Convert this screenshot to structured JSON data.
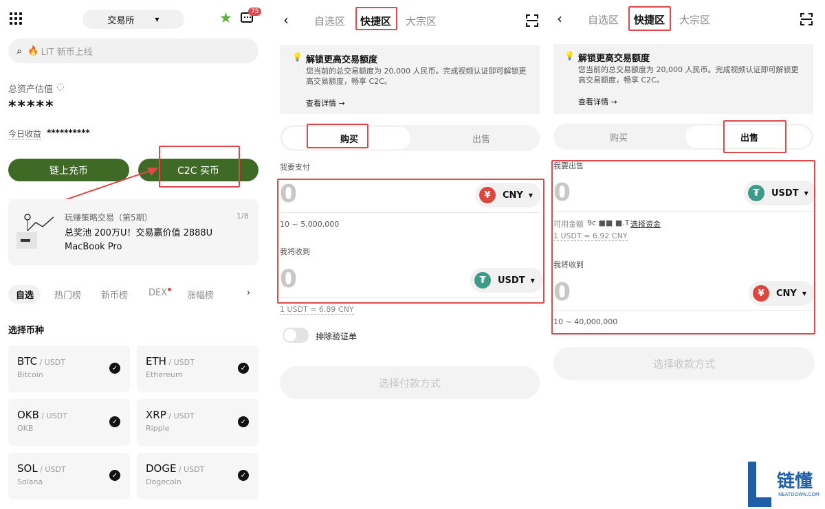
{
  "panel1": {
    "exchange_label": "交易所",
    "badge_count": "75",
    "search_placeholder": "LIT 新币上线",
    "assets_label": "总资产估值",
    "assets_value": "*****",
    "today_label": "今日收益",
    "today_value": "**********",
    "onchain_btn": "链上充币",
    "c2c_btn": "C2C 买币",
    "promo_title": "玩赚策略交易（第5期）",
    "promo_page": "1/8",
    "promo_text": "总奖池 200万U！交易赢价值 2888U MacBook Pro",
    "tabs": [
      "自选",
      "热门榜",
      "新币榜",
      "DEX",
      "涨幅榜"
    ],
    "section_title": "选择币种",
    "coins": [
      {
        "symbol": "BTC",
        "pair": " / USDT",
        "name": "Bitcoin"
      },
      {
        "symbol": "ETH",
        "pair": " / USDT",
        "name": "Ethereum"
      },
      {
        "symbol": "OKB",
        "pair": " / USDT",
        "name": "OKB"
      },
      {
        "symbol": "XRP",
        "pair": " / USDT",
        "name": "Ripple"
      },
      {
        "symbol": "SOL",
        "pair": " / USDT",
        "name": "Solana"
      },
      {
        "symbol": "DOGE",
        "pair": " / USDT",
        "name": "Dogecoin"
      }
    ]
  },
  "tabs": {
    "fav": "自选区",
    "quick": "快捷区",
    "bulk": "大宗区"
  },
  "banner": {
    "title": "解锁更高交易额度",
    "body": "您当前的总交易额度为 20,000 人民币。完成视频认证即可解锁更高交易额度，畅享 C2C。",
    "link": "查看详情 →"
  },
  "seg": {
    "buy": "购买",
    "sell": "出售"
  },
  "panel2": {
    "pay_label": "我要支付",
    "amount": "0",
    "pay_currency": "CNY",
    "pay_range": "10 ~ 5,000,000",
    "receive_label": "我将收到",
    "receive_amount": "0",
    "receive_currency": "USDT",
    "rate": "1 USDT ≈ 6.89 CNY",
    "toggle_label": "排除验证单",
    "action": "选择付款方式"
  },
  "panel3": {
    "sell_label": "我要出售",
    "amount": "0",
    "sell_currency": "USDT",
    "available_label": "可用金额",
    "available_value": "9c ■■ ■.T",
    "select_funds": "选择资金",
    "rate": "1 USDT ≈ 6.92 CNY",
    "receive_label": "我将收到",
    "receive_amount": "0",
    "receive_currency": "CNY",
    "receive_range": "10 ~ 40,000,000",
    "action": "选择收款方式"
  },
  "watermark": {
    "text": "链懂",
    "sub": "NEATDOWN.COM"
  },
  "colors": {
    "green": "#3f6a26",
    "red_box": "#e0484c",
    "cny": "#d9473d",
    "usdt": "#3e9a8a"
  }
}
